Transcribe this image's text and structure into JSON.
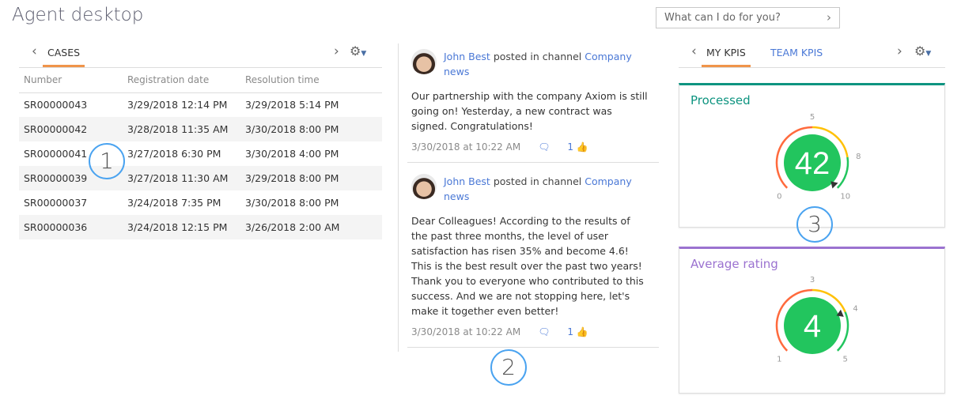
{
  "header": {
    "title": "Agent desktop",
    "search_placeholder": "What can I do for you?"
  },
  "cases": {
    "tab": "CASES",
    "columns": [
      "Number",
      "Registration date",
      "Resolution time"
    ],
    "rows": [
      [
        "SR00000043",
        "3/29/2018 12:14 PM",
        "3/29/2018 5:14 PM"
      ],
      [
        "SR00000042",
        "3/28/2018 11:35 AM",
        "3/30/2018 8:00 PM"
      ],
      [
        "SR00000041",
        "3/27/2018 6:30 PM",
        "3/30/2018 4:00 PM"
      ],
      [
        "SR00000039",
        "3/27/2018 11:30 AM",
        "3/29/2018 8:00 PM"
      ],
      [
        "SR00000037",
        "3/24/2018 7:35 PM",
        "3/30/2018 8:00 PM"
      ],
      [
        "SR00000036",
        "3/24/2018 12:15 PM",
        "3/26/2018 2:00 AM"
      ]
    ]
  },
  "feed": [
    {
      "author": "John Best",
      "action": "posted in channel",
      "channel": "Company news",
      "text": "Our partnership with the company Axiom is still going on! Yesterday, a new contract was signed. Congratulations!",
      "date": "3/30/2018 at 10:22 AM",
      "likes": "1"
    },
    {
      "author": "John Best",
      "action": "posted in channel",
      "channel": "Company news",
      "text": "Dear Colleagues! According to the results of the past three months, the level of user satisfaction has risen 35% and become 4.6! This is the best result over the past two years! Thank you to everyone who contributed to this success. And we are not stopping here, let's make it together even better!",
      "date": "3/30/2018 at 10:22 AM",
      "likes": "1"
    }
  ],
  "kpis": {
    "tabs": [
      "MY KPIS",
      "TEAM KPIS"
    ],
    "cards": [
      {
        "title": "Processed",
        "value": "42",
        "color": "#0e9480",
        "min": 0,
        "max": 10,
        "ticks": [
          "0",
          "5",
          "8",
          "10"
        ],
        "tick_values": [
          0,
          5,
          8,
          10
        ],
        "needle": 10
      },
      {
        "title": "Average rating",
        "value": "4",
        "color": "#9b72d0",
        "min": 1,
        "max": 5,
        "ticks": [
          "1",
          "3",
          "4",
          "5"
        ],
        "tick_values": [
          1,
          3,
          4,
          5
        ],
        "needle": 4
      }
    ]
  },
  "colors": {
    "low": "#ff6a3d",
    "mid": "#ffc107",
    "high": "#22c55e",
    "accent": "#f0944a",
    "link": "#4a78d6",
    "marker": "#4aa3f0"
  },
  "markers": [
    "1",
    "2",
    "3"
  ]
}
